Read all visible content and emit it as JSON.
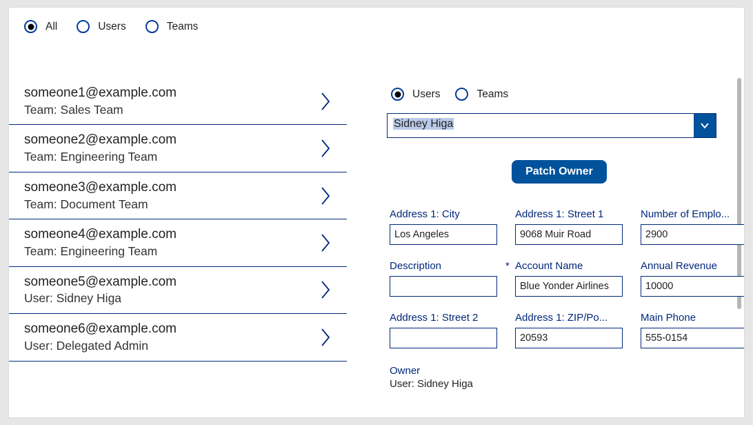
{
  "top_filter": {
    "options": [
      "All",
      "Users",
      "Teams"
    ],
    "selected_index": 0
  },
  "list": [
    {
      "primary": "someone1@example.com",
      "secondary": "Team: Sales Team"
    },
    {
      "primary": "someone2@example.com",
      "secondary": "Team: Engineering Team"
    },
    {
      "primary": "someone3@example.com",
      "secondary": "Team: Document Team"
    },
    {
      "primary": "someone4@example.com",
      "secondary": "Team: Engineering Team"
    },
    {
      "primary": "someone5@example.com",
      "secondary": "User: Sidney Higa"
    },
    {
      "primary": "someone6@example.com",
      "secondary": "User: Delegated Admin"
    }
  ],
  "right_radio": {
    "options": [
      "Users",
      "Teams"
    ],
    "selected_index": 0
  },
  "select": {
    "value": "Sidney Higa"
  },
  "patch_button": "Patch Owner",
  "fields": [
    {
      "label": "Address 1: City",
      "value": "Los Angeles",
      "required": false
    },
    {
      "label": "Address 1: Street 1",
      "value": "9068 Muir Road",
      "required": false
    },
    {
      "label": "Number of Emplo...",
      "value": "2900",
      "required": false
    },
    {
      "label": "Description",
      "value": "",
      "required": false
    },
    {
      "label": "Account Name",
      "value": "Blue Yonder Airlines",
      "required": true
    },
    {
      "label": "Annual Revenue",
      "value": "10000",
      "required": false
    },
    {
      "label": "Address 1: Street 2",
      "value": "",
      "required": false
    },
    {
      "label": "Address 1: ZIP/Po...",
      "value": "20593",
      "required": false
    },
    {
      "label": "Main Phone",
      "value": "555-0154",
      "required": false
    }
  ],
  "owner": {
    "label": "Owner",
    "value": "User: Sidney Higa"
  }
}
